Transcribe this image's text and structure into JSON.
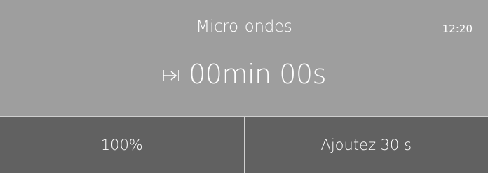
{
  "header": {
    "mode_title": "Micro-ondes",
    "clock": "12:20"
  },
  "timer": {
    "icon": "duration-icon",
    "value": "00min 00s"
  },
  "bottom_bar": {
    "power_label": "100%",
    "add_time_label": "Ajoutez 30 s"
  },
  "colors": {
    "top_panel_bg": "#9e9e9e",
    "bottom_bar_bg": "#616161",
    "text": "#ffffff"
  }
}
